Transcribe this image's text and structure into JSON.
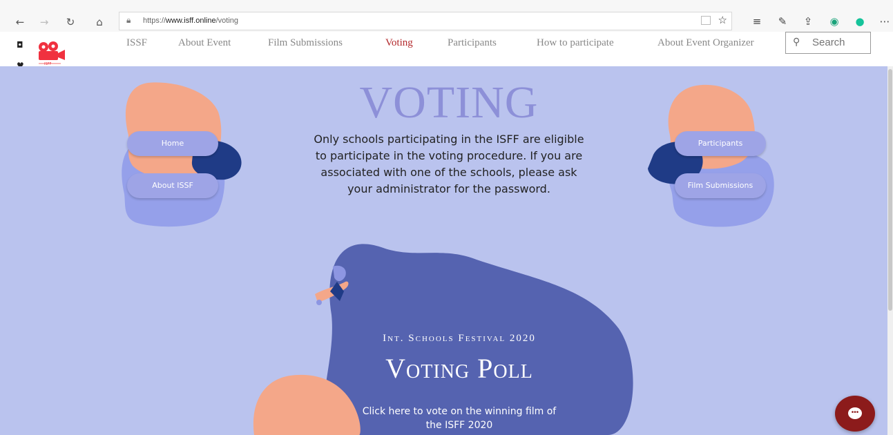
{
  "browser": {
    "url_prefix": "https://",
    "url_domain": "www.isff.online",
    "url_path": "/voting",
    "icons": [
      "back-arrow-icon",
      "forward-arrow-icon",
      "refresh-icon",
      "home-icon",
      "lock-icon",
      "reader-view-icon",
      "favorite-star-icon",
      "favorites-list-icon",
      "pen-icon",
      "share-icon",
      "extension-icon",
      "grammarly-icon",
      "more-icon"
    ]
  },
  "header": {
    "nav": [
      "ISSF",
      "About Event",
      "Film Submissions",
      "Voting",
      "Participants",
      "How to participate",
      "About Event Organizer"
    ],
    "active_nav": "Voting",
    "search_placeholder": "Search",
    "logo_text": "ISFF"
  },
  "hero": {
    "title": "VOTING",
    "intro_lines": [
      "Only schools participating in the ISFF are eligible",
      "to participate in the voting procedure. If you are",
      "associated with one of the schools, please ask",
      "your administrator for the password."
    ],
    "left_buttons": [
      "Home",
      "About ISSF"
    ],
    "right_buttons": [
      "Participants",
      "Film Submissions"
    ]
  },
  "poll": {
    "subtitle": "Int. Schools Festival 2020",
    "title": "Voting Poll",
    "click_lines": [
      "Click here to vote on the winning film of",
      "the ISFF 2020"
    ]
  },
  "chat": {
    "icon": "chat-bubble-icon"
  },
  "colors": {
    "background": "#bac3ee",
    "blob_peach": "#f4a789",
    "blob_navy": "#1f3b86",
    "blob_periwinkle": "#95a0ea",
    "poll_blob": "#5563b0",
    "pill": "#9ea4e6",
    "title": "#8d90d8",
    "active_nav": "#b2282b",
    "chat": "#8c1b1b"
  }
}
